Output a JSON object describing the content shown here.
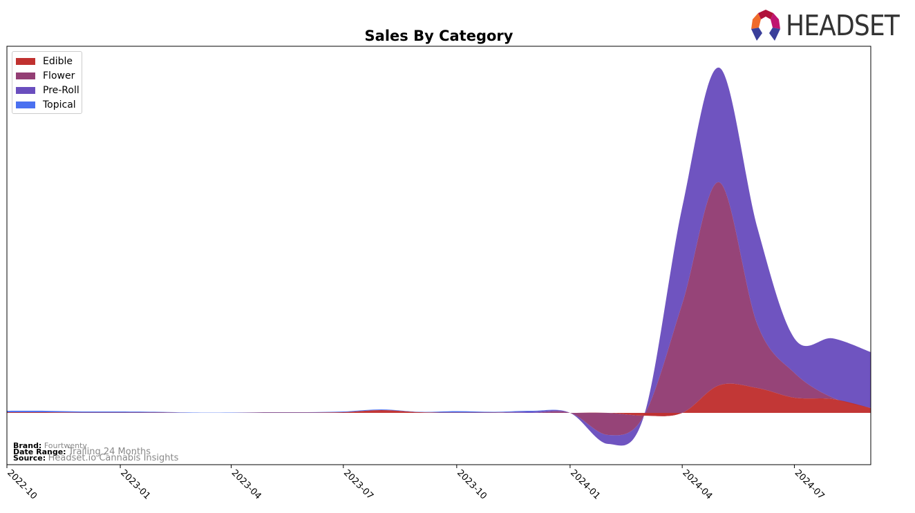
{
  "chart_data": {
    "type": "area",
    "stacked": true,
    "title": "Sales By Category",
    "xlabel": "",
    "ylabel": "",
    "x": [
      "2022-10",
      "2022-11",
      "2022-12",
      "2023-01",
      "2023-02",
      "2023-03",
      "2023-04",
      "2023-05",
      "2023-06",
      "2023-07",
      "2023-08",
      "2023-09",
      "2023-10",
      "2023-11",
      "2023-12",
      "2024-01",
      "2024-02",
      "2024-03",
      "2024-04",
      "2024-05",
      "2024-06",
      "2024-07",
      "2024-08",
      "2024-09"
    ],
    "x_ticks": [
      "2022-10",
      "2023-01",
      "2023-04",
      "2023-07",
      "2023-10",
      "2024-01",
      "2024-04",
      "2024-07"
    ],
    "ylim": [
      -75,
      531
    ],
    "y_ticks_shown": false,
    "grid": false,
    "legend_position": "top-left",
    "series": [
      {
        "name": "Edible",
        "color": "#c0312f",
        "values": [
          1,
          1,
          0.5,
          0.5,
          0.5,
          0,
          0,
          0.5,
          0.5,
          1,
          4,
          1,
          0.5,
          0.5,
          0,
          0,
          0,
          -4,
          0,
          40,
          36,
          22,
          20,
          7
        ]
      },
      {
        "name": "Flower",
        "color": "#933e74",
        "values": [
          0,
          0,
          0,
          0,
          0,
          0,
          0,
          0,
          0,
          0,
          0,
          0,
          0,
          0,
          0,
          0,
          -32,
          0,
          158,
          294,
          92,
          36,
          2,
          0
        ]
      },
      {
        "name": "Pre-Roll",
        "color": "#6a4ebe",
        "values": [
          0,
          0,
          0,
          0,
          0,
          0,
          0,
          0,
          0,
          0,
          0,
          0,
          0,
          0,
          2,
          0,
          -13,
          0,
          140,
          166,
          140,
          50,
          86,
          81
        ]
      },
      {
        "name": "Topical",
        "color": "#4a70f0",
        "values": [
          2,
          2,
          1.5,
          1.5,
          1,
          0.5,
          0.5,
          0.5,
          0.5,
          1,
          1,
          0.5,
          2,
          1,
          1,
          0,
          0,
          0,
          0,
          0,
          0,
          0,
          0,
          0
        ]
      }
    ]
  },
  "meta": {
    "brand_label": "Brand:",
    "brand": "Fourtwenty",
    "date_range_label": "Date Range:",
    "date_range": "Trailing 24 Months",
    "source_label": "Source:",
    "source": "Headset.io Cannabis Insights"
  },
  "logo": {
    "text": "HEADSET"
  }
}
